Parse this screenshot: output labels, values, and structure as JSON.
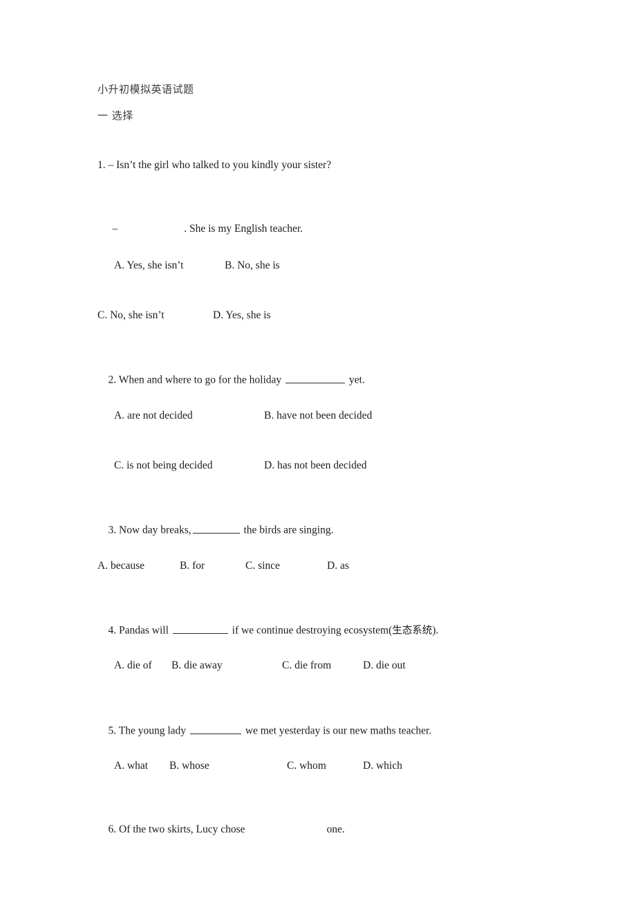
{
  "document": {
    "title": "小升初模拟英语试题",
    "section_heading": "一 选择"
  },
  "questions": [
    {
      "number": "1.",
      "stem_line_1": "1. – Isn’t the girl who talked to you kindly your sister?",
      "stem_line_2_dash": "–",
      "stem_line_2_tail": ". She is my English teacher.",
      "options": [
        {
          "label": "A. Yes, she isn’t"
        },
        {
          "label": "B. No, she is"
        },
        {
          "label": "C. No, she isn’t"
        },
        {
          "label": "D. Yes, she is"
        }
      ]
    },
    {
      "number": "2.",
      "stem_before_blank": "2. When and where to go for the holiday ",
      "stem_after_blank": " yet.",
      "options": [
        {
          "label": "A. are not decided"
        },
        {
          "label": "B. have not been decided"
        },
        {
          "label": "C. is not being decided"
        },
        {
          "label": "D. has not been decided"
        }
      ]
    },
    {
      "number": "3.",
      "stem_before_blank": "3. Now day breaks,",
      "stem_after_blank": " the birds are singing.",
      "options": [
        {
          "label": "A. because"
        },
        {
          "label": "B. for"
        },
        {
          "label": "C. since"
        },
        {
          "label": "D. as"
        }
      ]
    },
    {
      "number": "4.",
      "stem_before_blank": "4. Pandas will ",
      "stem_after_blank": " if we continue destroying ecosystem(",
      "stem_cjk_gloss": "生态系统",
      "stem_tail": ").",
      "options": [
        {
          "label": "A. die of"
        },
        {
          "label": "B. die away"
        },
        {
          "label": "C. die from"
        },
        {
          "label": "D. die out"
        }
      ]
    },
    {
      "number": "5.",
      "stem_before_blank": "5. The young lady ",
      "stem_after_blank": " we met yesterday is our new maths teacher.",
      "options": [
        {
          "label": "A. what"
        },
        {
          "label": "B. whose"
        },
        {
          "label": "C. whom"
        },
        {
          "label": "D. which"
        }
      ]
    },
    {
      "number": "6.",
      "stem_before_blank": "6. Of the two skirts, Lucy chose",
      "stem_after_blank": "one."
    }
  ]
}
